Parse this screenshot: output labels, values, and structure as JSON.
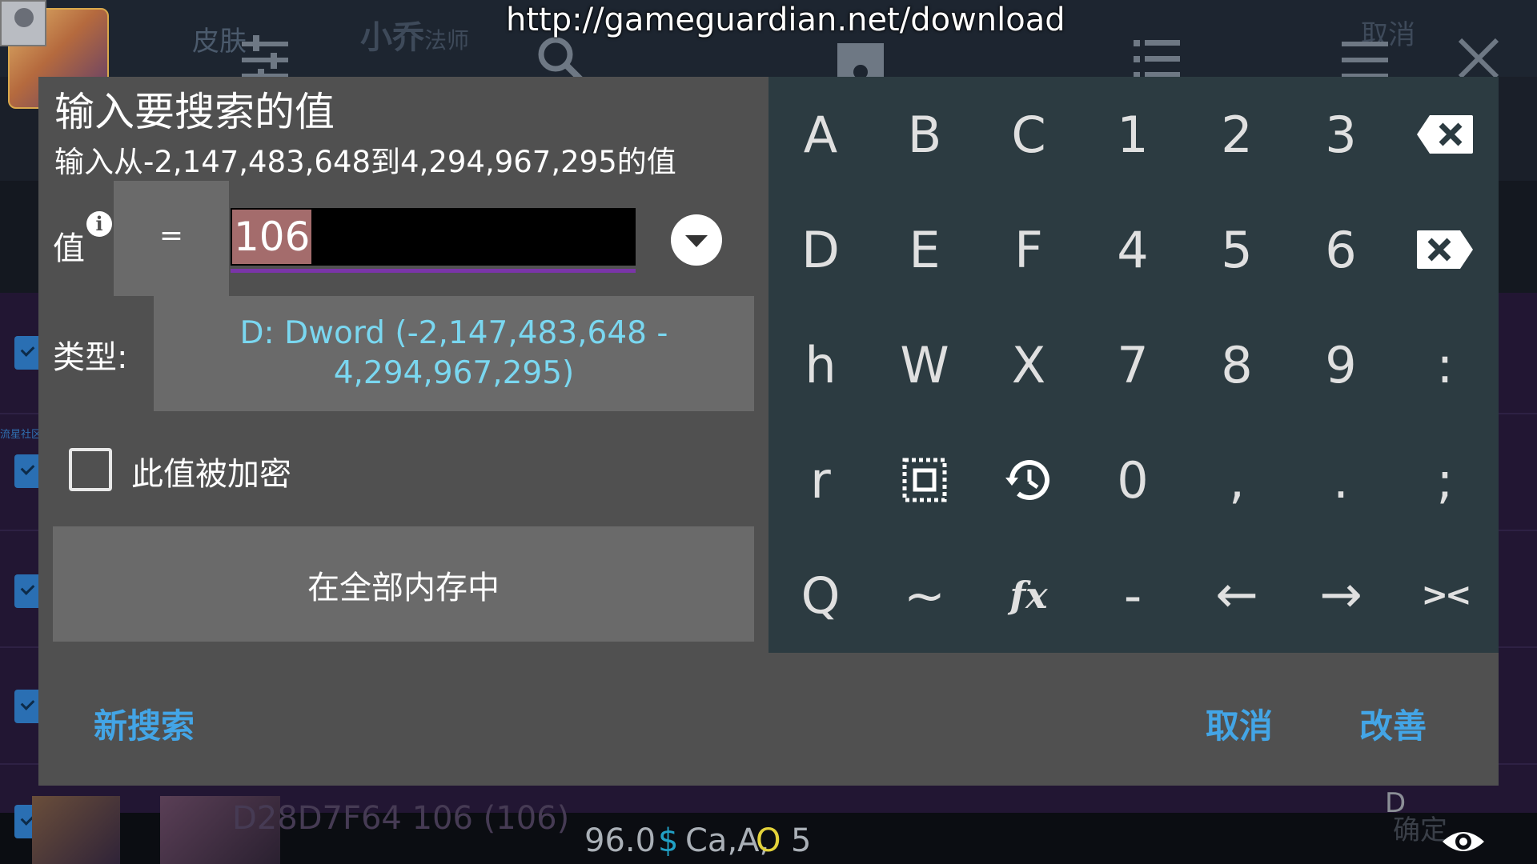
{
  "background": {
    "skin_tab": "皮肤",
    "hero_name": "小乔",
    "hero_role": "法师",
    "cancel": "取消",
    "community": "流星社区",
    "row_text": "D28D7F64      106 (106)",
    "confirm": "确定",
    "d_marker": "D"
  },
  "toolbar": {
    "url": "http://gameguardian.net/download"
  },
  "dialog": {
    "title": "输入要搜索的值",
    "hint": "输入从-2,147,483,648到4,294,967,295的值",
    "value_label": "值",
    "info_icon": "i",
    "operator": "=",
    "value": "106",
    "type_label": "类型:",
    "type_value": "D: Dword (-2,147,483,648 - 4,294,967,295)",
    "encrypted_label": "此值被加密",
    "encrypted_checked": false,
    "memory_button": "在全部内存中",
    "new_search": "新搜索",
    "cancel": "取消",
    "improve": "改善"
  },
  "keypad": {
    "rows": [
      [
        "A",
        "B",
        "C",
        "1",
        "2",
        "3",
        "backspace-icon"
      ],
      [
        "D",
        "E",
        "F",
        "4",
        "5",
        "6",
        "delete-icon"
      ],
      [
        "h",
        "W",
        "X",
        "7",
        "8",
        "9",
        ":"
      ],
      [
        "r",
        "select-all-icon",
        "history-icon",
        "0",
        ",",
        ".",
        ";"
      ],
      [
        "Q",
        "~",
        "fx",
        "-",
        "←",
        "→",
        "><"
      ]
    ]
  },
  "status_bar": {
    "number": "96.0",
    "dollar": "$",
    "letters": "Ca,A,",
    "o_letter": "O",
    "count": "5"
  },
  "colors": {
    "dialog_bg": "#505050",
    "keypad_bg": "#2c3b41",
    "accent_blue": "#43a5e6",
    "type_text": "#7ad7f0",
    "underline_purple": "#7a35a8"
  }
}
